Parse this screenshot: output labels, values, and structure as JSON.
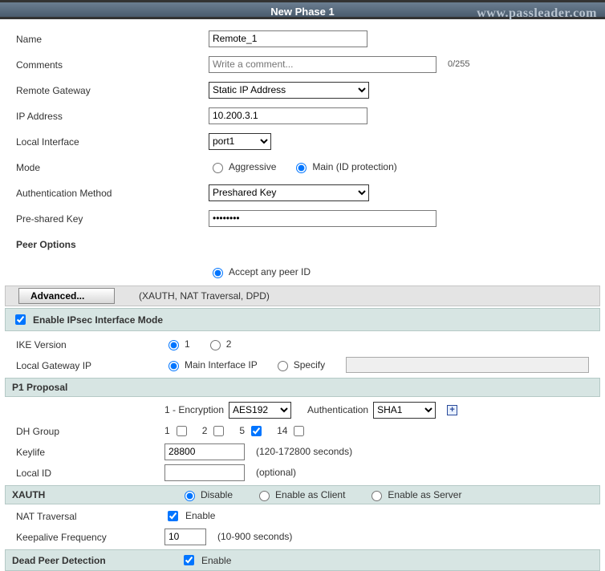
{
  "watermark": "www.passleader.com",
  "title": "New Phase 1",
  "labels": {
    "name": "Name",
    "comments": "Comments",
    "remote_gateway": "Remote Gateway",
    "ip_address": "IP Address",
    "local_interface": "Local Interface",
    "mode": "Mode",
    "auth_method": "Authentication Method",
    "psk": "Pre-shared Key",
    "peer_options": "Peer Options",
    "ike_version": "IKE Version",
    "local_gw_ip": "Local Gateway IP",
    "p1_proposal": "P1 Proposal",
    "dh_group": "DH Group",
    "keylife": "Keylife",
    "local_id": "Local ID",
    "xauth": "XAUTH",
    "nat_traversal": "NAT Traversal",
    "keepalive": "Keepalive Frequency",
    "dpd": "Dead Peer Detection"
  },
  "values": {
    "name": "Remote_1",
    "comments_placeholder": "Write a comment...",
    "comments_counter": "0/255",
    "remote_gateway": "Static IP Address",
    "ip_address": "10.200.3.1",
    "local_interface": "port1",
    "auth_method": "Preshared Key",
    "psk": "••••••••",
    "keylife": "28800",
    "keepalive": "10",
    "encryption": "AES192",
    "authentication": "SHA1",
    "local_id": ""
  },
  "options": {
    "mode_aggressive": "Aggressive",
    "mode_main": "Main (ID protection)",
    "accept_any_peer": "Accept any peer ID",
    "advanced_btn": "Advanced...",
    "advanced_desc": "(XAUTH, NAT Traversal, DPD)",
    "enable_ipsec_if": "Enable IPsec Interface Mode",
    "ike_1": "1",
    "ike_2": "2",
    "main_if_ip": "Main Interface IP",
    "specify": "Specify",
    "enc_prefix": "1 - Encryption",
    "auth_label": "Authentication",
    "dh_1": "1",
    "dh_2": "2",
    "dh_5": "5",
    "dh_14": "14",
    "keylife_hint": "(120-172800 seconds)",
    "local_id_hint": "(optional)",
    "xauth_disable": "Disable",
    "xauth_client": "Enable as Client",
    "xauth_server": "Enable as Server",
    "enable": "Enable",
    "keepalive_hint": "(10-900 seconds)"
  }
}
